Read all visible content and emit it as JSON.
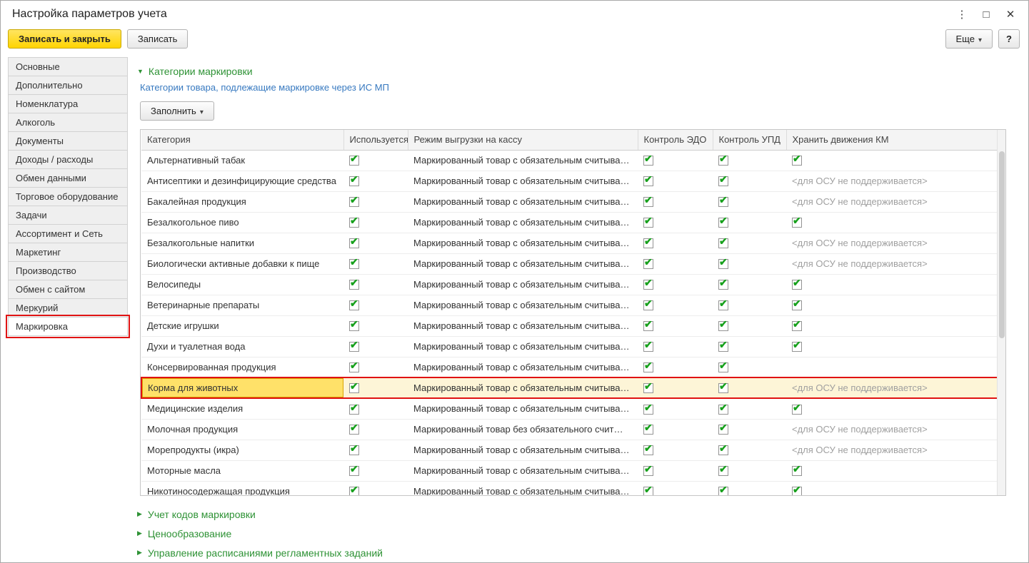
{
  "window": {
    "title": "Настройка параметров учета"
  },
  "icons": {
    "kebab": "⋮",
    "maximize": "□",
    "close": "✕",
    "caret_down": "▾",
    "triangle_expanded": "▼",
    "triangle_collapsed": "▶",
    "check": "✔"
  },
  "toolbar": {
    "save_close_label": "Записать и закрыть",
    "save_label": "Записать",
    "more_label": "Еще",
    "help_label": "?"
  },
  "sidebar": {
    "items": [
      {
        "id": "osnovnye",
        "label": "Основные"
      },
      {
        "id": "dopolnitelno",
        "label": "Дополнительно"
      },
      {
        "id": "nomenklatura",
        "label": "Номенклатура"
      },
      {
        "id": "alkogol",
        "label": "Алкоголь"
      },
      {
        "id": "dokumenty",
        "label": "Документы"
      },
      {
        "id": "dohody-rashody",
        "label": "Доходы / расходы"
      },
      {
        "id": "obmen-dannymi",
        "label": "Обмен данными"
      },
      {
        "id": "torgovoe-oborudovanie",
        "label": "Торговое оборудование"
      },
      {
        "id": "zadachi",
        "label": "Задачи"
      },
      {
        "id": "assortiment-i-set",
        "label": "Ассортимент и Сеть"
      },
      {
        "id": "marketing",
        "label": "Маркетинг"
      },
      {
        "id": "proizvodstvo",
        "label": "Производство"
      },
      {
        "id": "obmen-s-saytom",
        "label": "Обмен с сайтом"
      },
      {
        "id": "merkuriy",
        "label": "Меркурий"
      },
      {
        "id": "markirovka",
        "label": "Маркировка",
        "active": true,
        "annotated": true
      }
    ]
  },
  "main": {
    "section_title": "Категории маркировки",
    "subtitle": "Категории товара, подлежащие маркировке через ИС МП",
    "fill_button_label": "Заполнить",
    "table": {
      "columns": [
        "Категория",
        "Используется",
        "Режим выгрузки на кассу",
        "Контроль ЭДО",
        "Контроль УПД",
        "Хранить движения КМ"
      ],
      "unsupported_text": "<для ОСУ не поддерживается>",
      "rows": [
        {
          "category": "Альтернативный табак",
          "used": true,
          "mode": "Маркированный товар с обязательным считыва…",
          "edo": true,
          "upd": true,
          "km": "check"
        },
        {
          "category": "Антисептики и дезинфицирующие средства",
          "used": true,
          "mode": "Маркированный товар с обязательным считыва…",
          "edo": true,
          "upd": true,
          "km": "unsupported"
        },
        {
          "category": "Бакалейная продукция",
          "used": true,
          "mode": "Маркированный товар с обязательным считыва…",
          "edo": true,
          "upd": true,
          "km": "unsupported"
        },
        {
          "category": "Безалкогольное пиво",
          "used": true,
          "mode": "Маркированный товар с обязательным считыва…",
          "edo": true,
          "upd": true,
          "km": "check"
        },
        {
          "category": "Безалкогольные напитки",
          "used": true,
          "mode": "Маркированный товар с обязательным считыва…",
          "edo": true,
          "upd": true,
          "km": "unsupported"
        },
        {
          "category": "Биологически активные добавки к пище",
          "used": true,
          "mode": "Маркированный товар с обязательным считыва…",
          "edo": true,
          "upd": true,
          "km": "unsupported"
        },
        {
          "category": "Велосипеды",
          "used": true,
          "mode": "Маркированный товар с обязательным считыва…",
          "edo": true,
          "upd": true,
          "km": "check"
        },
        {
          "category": "Ветеринарные препараты",
          "used": true,
          "mode": "Маркированный товар с обязательным считыва…",
          "edo": true,
          "upd": true,
          "km": "check"
        },
        {
          "category": "Детские игрушки",
          "used": true,
          "mode": "Маркированный товар с обязательным считыва…",
          "edo": true,
          "upd": true,
          "km": "check"
        },
        {
          "category": "Духи и туалетная вода",
          "used": true,
          "mode": "Маркированный товар с обязательным считыва…",
          "edo": true,
          "upd": true,
          "km": "check"
        },
        {
          "category": "Консервированная продукция",
          "used": true,
          "mode": "Маркированный товар с обязательным считыва…",
          "edo": true,
          "upd": true,
          "km": "none"
        },
        {
          "category": "Корма для животных",
          "used": true,
          "mode": "Маркированный товар с обязательным считыва…",
          "edo": true,
          "upd": true,
          "km": "unsupported",
          "highlighted": true
        },
        {
          "category": "Медицинские изделия",
          "used": true,
          "mode": "Маркированный товар с обязательным считыва…",
          "edo": true,
          "upd": true,
          "km": "check"
        },
        {
          "category": "Молочная продукция",
          "used": true,
          "mode": "Маркированный товар без обязательного счит…",
          "edo": true,
          "upd": true,
          "km": "unsupported"
        },
        {
          "category": "Морепродукты (икра)",
          "used": true,
          "mode": "Маркированный товар с обязательным считыва…",
          "edo": true,
          "upd": true,
          "km": "unsupported"
        },
        {
          "category": "Моторные масла",
          "used": true,
          "mode": "Маркированный товар с обязательным считыва…",
          "edo": true,
          "upd": true,
          "km": "check"
        },
        {
          "category": "Никотиносодержащая продукция",
          "used": true,
          "mode": "Маркированный товар с обязательным считыва…",
          "edo": true,
          "upd": true,
          "km": "check"
        }
      ]
    },
    "collapsed_sections": [
      {
        "id": "uchet-kodov-markirovki",
        "label": "Учет кодов маркировки"
      },
      {
        "id": "tsenoobrazovanie",
        "label": "Ценообразование"
      },
      {
        "id": "upravlenie-raspisaniyami",
        "label": "Управление расписаниями регламентных заданий"
      }
    ]
  }
}
